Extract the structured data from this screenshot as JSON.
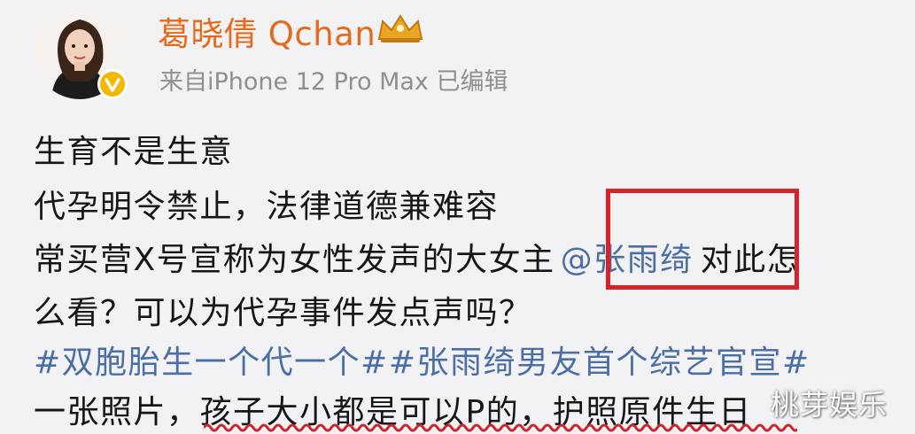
{
  "post": {
    "author": {
      "name": "葛晓倩 Qchan",
      "source": "来自iPhone 12 Pro Max  已编辑"
    },
    "content": {
      "line1": "生育不是生意",
      "line2": "代孕明令禁止，法律道德兼难容",
      "line3_before": "常买营X号宣称为女性发声的大女主",
      "mention": "@张雨绮",
      "line3_after": "对此怎",
      "line4": "么看？可以为代孕事件发点声吗？",
      "line5": "#双胞胎生一个代一个##张雨绮男友首个综艺官宣#",
      "line6": "一张照片，孩子大小都是可以P的，护照原件生日"
    }
  },
  "watermark": "桃芽娱乐",
  "colors": {
    "username": "#e46b1c",
    "link": "#4b6fa5",
    "highlight_box": "#d4242a",
    "underline": "#d4242a"
  }
}
